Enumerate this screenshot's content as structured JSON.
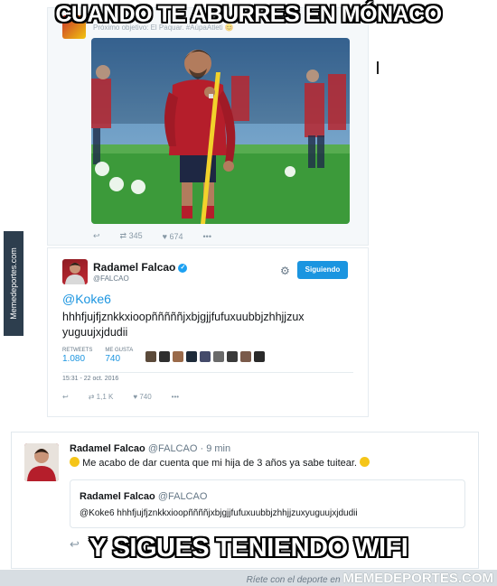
{
  "meme": {
    "top_caption": "CUANDO TE ABURRES EN MÓNACO",
    "bottom_caption": "Y SIGUES TENIENDO WIFI"
  },
  "tweet1": {
    "faded_header": "Próximo objetivo: El Paquar. #AúpaAtleti 😊",
    "retweets": "345",
    "likes": "674"
  },
  "tweet2": {
    "name": "Radamel Falcao",
    "handle": "@FALCAO",
    "follow_label": "Siguiendo",
    "mention": "@Koke6",
    "text": "hhhfjujfjznkkxioopñññññjxbjgjjfufuxuubbjzhhjjzux yuguujxjdudii",
    "retweets_label": "RETWEETS",
    "retweets": "1.080",
    "likes_label": "ME GUSTA",
    "likes": "740",
    "date": "15:31 - 22 oct. 2016",
    "action_retweets": "1,1 K",
    "action_likes": "740"
  },
  "tweet3": {
    "name": "Radamel Falcao",
    "handle": "@FALCAO",
    "time": "· 9 min",
    "text": "Me acabo de dar cuenta que mi hija de 3 años ya sabe tuitear.",
    "quote_name": "Radamel Falcao",
    "quote_handle": "@FALCAO",
    "quote_text": "@Koke6 hhhfjujfjznkkxioopññññjxbjgjjfufuxuubbjzhhjjzuxyuguujxjdudii"
  },
  "watermark": {
    "side": "Memedeportes.com",
    "footer_text": "Ríete con el deporte en ",
    "footer_brand": "MEMEDEPORTES.COM"
  },
  "colors": {
    "twitter_blue": "#1b95e0",
    "atletico_red": "#c02a34"
  }
}
